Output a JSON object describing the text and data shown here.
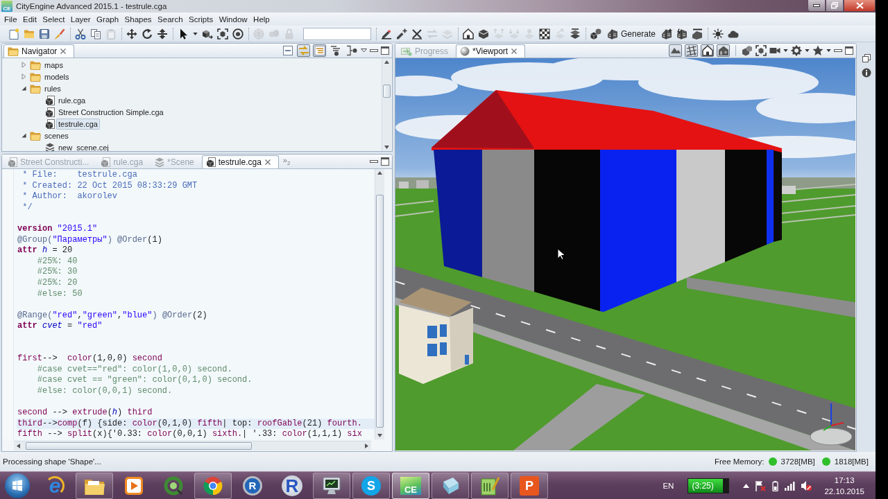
{
  "window": {
    "icon_label": "CE",
    "title": "CityEngine Advanced 2015.1 - testrule.cga"
  },
  "menu": [
    "File",
    "Edit",
    "Select",
    "Layer",
    "Graph",
    "Shapes",
    "Search",
    "Scripts",
    "Window",
    "Help"
  ],
  "toolbar": {
    "groups": [
      [
        {
          "kind": "icon",
          "disabled": false
        },
        {
          "kind": "icon",
          "disabled": false
        },
        {
          "kind": "icon",
          "disabled": false
        },
        {
          "kind": "icon",
          "disabled": false
        }
      ],
      [
        {
          "kind": "icon",
          "disabled": false
        },
        {
          "kind": "icon",
          "disabled": false
        },
        {
          "kind": "icon",
          "disabled": true
        }
      ],
      [
        {
          "kind": "icon",
          "disabled": false
        },
        {
          "kind": "icon",
          "disabled": false
        },
        {
          "kind": "icon",
          "disabled": false
        }
      ],
      [
        {
          "kind": "icon",
          "disabled": false
        },
        {
          "kind": "dropdown",
          "disabled": false
        },
        {
          "kind": "icon",
          "disabled": false
        },
        {
          "kind": "icon",
          "disabled": false
        },
        {
          "kind": "icon",
          "disabled": false
        }
      ],
      [
        {
          "kind": "icon",
          "disabled": true
        },
        {
          "kind": "icon",
          "disabled": true
        },
        {
          "kind": "icon",
          "disabled": true
        },
        {
          "kind": "field"
        }
      ],
      [
        {
          "kind": "icon",
          "disabled": false
        },
        {
          "kind": "icon",
          "disabled": false
        },
        {
          "kind": "icon",
          "disabled": false
        },
        {
          "kind": "icon",
          "disabled": true
        },
        {
          "kind": "icon",
          "disabled": true
        }
      ],
      [
        {
          "kind": "icon",
          "disabled": false
        },
        {
          "kind": "icon",
          "disabled": false
        },
        {
          "kind": "icon",
          "disabled": true
        },
        {
          "kind": "icon",
          "disabled": true
        },
        {
          "kind": "icon",
          "disabled": true
        },
        {
          "kind": "icon",
          "disabled": false
        },
        {
          "kind": "icon",
          "disabled": true
        },
        {
          "kind": "icon",
          "disabled": false
        }
      ],
      [
        {
          "kind": "icon",
          "disabled": false
        },
        {
          "kind": "button",
          "label": "Generate",
          "disabled": false
        },
        {
          "kind": "icon",
          "disabled": false
        },
        {
          "kind": "icon",
          "disabled": false
        },
        {
          "kind": "icon",
          "disabled": false
        }
      ],
      [
        {
          "kind": "icon",
          "disabled": false
        },
        {
          "kind": "icon",
          "disabled": false
        }
      ]
    ]
  },
  "navigator": {
    "title": "Navigator",
    "toolbar": [
      {
        "pressed": false
      },
      {
        "pressed": true
      },
      {
        "pressed": true
      },
      {
        "pressed": false
      },
      {
        "pressed": false
      }
    ],
    "tree": [
      {
        "label": "maps",
        "kind": "folder",
        "expanded": false,
        "selected": false
      },
      {
        "label": "models",
        "kind": "folder",
        "expanded": false,
        "selected": false
      },
      {
        "label": "rules",
        "kind": "folder",
        "expanded": true,
        "selected": false,
        "children": [
          {
            "label": "rule.cga",
            "kind": "rule",
            "selected": false
          },
          {
            "label": "Street Construction Simple.cga",
            "kind": "rule",
            "selected": false
          },
          {
            "label": "testrule.cga",
            "kind": "rule",
            "selected": true
          }
        ]
      },
      {
        "label": "scenes",
        "kind": "folder",
        "expanded": true,
        "selected": false,
        "children": [
          {
            "label": "new_scene.cej",
            "kind": "scene",
            "selected": false
          }
        ]
      }
    ]
  },
  "editor": {
    "tabs": [
      {
        "label": "Street Constructi...",
        "kind": "rule",
        "selected": false
      },
      {
        "label": "rule.cga",
        "kind": "rule",
        "selected": false
      },
      {
        "label": "*Scene",
        "kind": "scene",
        "selected": false
      },
      {
        "label": "testrule.cga",
        "kind": "rule",
        "selected": true
      }
    ],
    "overflow": {
      "symbol": "»",
      "count": "2"
    },
    "lines": [
      {
        "highlighted": false,
        "tokens": [
          {
            "text": " * File:    testrule.cga",
            "kind": "comment"
          }
        ]
      },
      {
        "highlighted": false,
        "tokens": [
          {
            "text": " * Created: 22 Oct 2015 08:33:29 GMT",
            "kind": "comment"
          }
        ]
      },
      {
        "highlighted": false,
        "tokens": [
          {
            "text": " * Author:  akorolev",
            "kind": "comment"
          }
        ]
      },
      {
        "highlighted": false,
        "tokens": [
          {
            "text": " */",
            "kind": "comment"
          }
        ]
      },
      {
        "highlighted": false
      },
      {
        "highlighted": false,
        "tokens": [
          {
            "text": "version",
            "kind": "keyword"
          },
          {
            "text": " \"2015.1\"",
            "kind": "string"
          }
        ]
      },
      {
        "highlighted": false,
        "tokens": [
          {
            "text": "@Group(",
            "kind": "annotation"
          },
          {
            "text": "\"Параметры\"",
            "kind": "string"
          },
          {
            "text": ") @Order",
            "kind": "annotation"
          },
          {
            "text": "(1)",
            "kind": "plain"
          }
        ]
      },
      {
        "highlighted": false,
        "tokens": [
          {
            "text": "attr ",
            "kind": "keyword"
          },
          {
            "text": "h",
            "kind": "attribute"
          },
          {
            "text": " = 20",
            "kind": "plain"
          }
        ]
      },
      {
        "highlighted": false,
        "tokens": [
          {
            "text": "    #25%: 40",
            "kind": "hash"
          }
        ]
      },
      {
        "highlighted": false,
        "tokens": [
          {
            "text": "    #25%: 30",
            "kind": "hash"
          }
        ]
      },
      {
        "highlighted": false,
        "tokens": [
          {
            "text": "    #25%: 20",
            "kind": "hash"
          }
        ]
      },
      {
        "highlighted": false,
        "tokens": [
          {
            "text": "    #else: 50",
            "kind": "hash"
          }
        ]
      },
      {
        "highlighted": false
      },
      {
        "highlighted": false,
        "tokens": [
          {
            "text": "@Range(",
            "kind": "annotation"
          },
          {
            "text": "\"red\"",
            "kind": "string"
          },
          {
            "text": ",",
            "kind": "plain"
          },
          {
            "text": "\"green\"",
            "kind": "string"
          },
          {
            "text": ",",
            "kind": "plain"
          },
          {
            "text": "\"blue\"",
            "kind": "string"
          },
          {
            "text": ") @Order",
            "kind": "annotation"
          },
          {
            "text": "(2)",
            "kind": "plain"
          }
        ]
      },
      {
        "highlighted": false,
        "tokens": [
          {
            "text": "attr ",
            "kind": "keyword"
          },
          {
            "text": "cvet",
            "kind": "attribute"
          },
          {
            "text": " = ",
            "kind": "plain"
          },
          {
            "text": "\"red\"",
            "kind": "string"
          }
        ]
      },
      {
        "highlighted": false
      },
      {
        "highlighted": false
      },
      {
        "highlighted": false,
        "tokens": [
          {
            "text": "first",
            "kind": "rule"
          },
          {
            "text": "-->  ",
            "kind": "plain"
          },
          {
            "text": "color",
            "kind": "rule"
          },
          {
            "text": "(1,0,0) ",
            "kind": "plain"
          },
          {
            "text": "second",
            "kind": "rule"
          }
        ]
      },
      {
        "highlighted": false,
        "tokens": [
          {
            "text": "    #case cvet==\"red\": color(1,0,0) second.",
            "kind": "hash"
          }
        ]
      },
      {
        "highlighted": false,
        "tokens": [
          {
            "text": "    #case cvet == \"green\": color(0,1,0) second.",
            "kind": "hash"
          }
        ]
      },
      {
        "highlighted": false,
        "tokens": [
          {
            "text": "    #else: color(0,0,1) second.",
            "kind": "hash"
          }
        ]
      },
      {
        "highlighted": false
      },
      {
        "highlighted": false,
        "tokens": [
          {
            "text": "second",
            "kind": "rule"
          },
          {
            "text": " --> ",
            "kind": "plain"
          },
          {
            "text": "extrude",
            "kind": "rule"
          },
          {
            "text": "(",
            "kind": "plain"
          },
          {
            "text": "h",
            "kind": "attribute"
          },
          {
            "text": ") ",
            "kind": "plain"
          },
          {
            "text": "third",
            "kind": "rule"
          }
        ]
      },
      {
        "highlighted": true,
        "tokens": [
          {
            "text": "third",
            "kind": "rule"
          },
          {
            "text": "-->",
            "kind": "plain"
          },
          {
            "text": "comp",
            "kind": "rule"
          },
          {
            "text": "(f) {side: ",
            "kind": "plain"
          },
          {
            "text": "color",
            "kind": "rule"
          },
          {
            "text": "(0,1,0) ",
            "kind": "plain"
          },
          {
            "text": "fifth",
            "kind": "rule"
          },
          {
            "text": "| top: ",
            "kind": "plain"
          },
          {
            "text": "roofGable",
            "kind": "rule"
          },
          {
            "text": "(21) ",
            "kind": "plain"
          },
          {
            "text": "fourth.",
            "kind": "rule"
          }
        ]
      },
      {
        "highlighted": false,
        "tokens": [
          {
            "text": "fifth",
            "kind": "rule"
          },
          {
            "text": " --> ",
            "kind": "plain"
          },
          {
            "text": "split",
            "kind": "rule"
          },
          {
            "text": "(x){'0.33: ",
            "kind": "plain"
          },
          {
            "text": "color",
            "kind": "rule"
          },
          {
            "text": "(0,0,1) ",
            "kind": "plain"
          },
          {
            "text": "sixth.",
            "kind": "rule"
          },
          {
            "text": "| '.33: ",
            "kind": "plain"
          },
          {
            "text": "color",
            "kind": "rule"
          },
          {
            "text": "(1,1,1) ",
            "kind": "plain"
          },
          {
            "text": "six",
            "kind": "rule"
          }
        ]
      }
    ]
  },
  "viewport_panel": {
    "tabs": [
      {
        "label": "Progress",
        "kind": "progress",
        "selected": false
      },
      {
        "label": "*Viewport",
        "kind": "viewport",
        "selected": true
      }
    ],
    "view_toggles": [
      {
        "pressed": true
      },
      {
        "pressed": true
      },
      {
        "pressed": true
      },
      {
        "pressed": true
      }
    ]
  },
  "status_bar": {
    "message": "Processing shape 'Shape'...",
    "memory_label": "Free Memory:",
    "memory": [
      {
        "value": "3728[MB]",
        "color": "#2fbf2a"
      },
      {
        "value": "1818[MB]",
        "color": "#2fbf2a"
      }
    ]
  },
  "taskbar": {
    "apps": [
      {
        "label": "e",
        "running": false,
        "selected": false
      },
      {
        "running": true,
        "selected": false
      },
      {
        "running": false,
        "selected": false
      },
      {
        "running": false,
        "selected": false
      },
      {
        "running": true,
        "selected": false
      },
      {
        "label": "R",
        "running": false,
        "selected": false
      },
      {
        "label": "R",
        "running": false,
        "selected": false
      },
      {
        "running": true,
        "selected": false
      },
      {
        "label": "S",
        "running": true,
        "selected": false
      },
      {
        "label": "CE",
        "running": true,
        "selected": true
      },
      {
        "running": true,
        "selected": false
      },
      {
        "running": true,
        "selected": false
      },
      {
        "label": "P",
        "running": true,
        "selected": false
      }
    ],
    "language": "EN",
    "battery": {
      "label": "(3:25)",
      "level": 0.85
    },
    "clock": {
      "time": "17:13",
      "date": "22.10.2015"
    }
  }
}
